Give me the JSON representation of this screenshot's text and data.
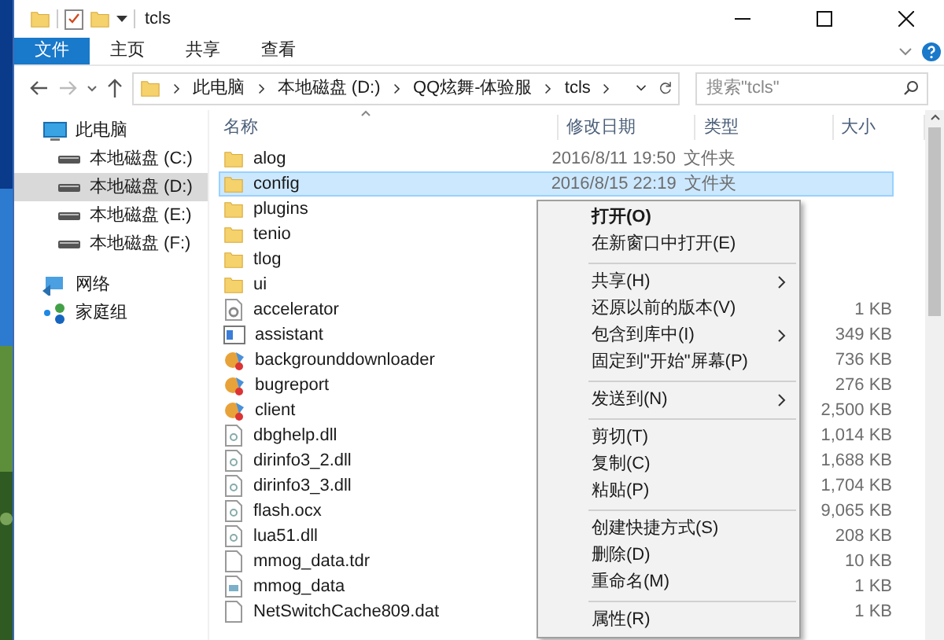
{
  "window": {
    "title": "tcls"
  },
  "ribbon_tabs": [
    {
      "label": "文件",
      "selected": true
    },
    {
      "label": "主页",
      "selected": false
    },
    {
      "label": "共享",
      "selected": false
    },
    {
      "label": "查看",
      "selected": false
    }
  ],
  "address_bar": {
    "crumbs": [
      "此电脑",
      "本地磁盘 (D:)",
      "QQ炫舞-体验服",
      "tcls"
    ]
  },
  "search": {
    "placeholder": "搜索\"tcls\""
  },
  "sidebar": {
    "items": [
      {
        "label": "此电脑",
        "kind": "pc",
        "selected": false
      },
      {
        "label": "本地磁盘 (C:)",
        "kind": "drive",
        "selected": false
      },
      {
        "label": "本地磁盘 (D:)",
        "kind": "drive",
        "selected": true
      },
      {
        "label": "本地磁盘 (E:)",
        "kind": "drive",
        "selected": false
      },
      {
        "label": "本地磁盘 (F:)",
        "kind": "drive",
        "selected": false
      },
      {
        "label": "网络",
        "kind": "network",
        "selected": false
      },
      {
        "label": "家庭组",
        "kind": "homegroup",
        "selected": false
      }
    ]
  },
  "table": {
    "columns": [
      "名称",
      "修改日期",
      "类型",
      "大小"
    ],
    "rows": [
      {
        "name": "alog",
        "kind": "folder",
        "selected": false,
        "date": "2016/8/11 19:50",
        "type": "文件夹"
      },
      {
        "name": "config",
        "kind": "folder",
        "selected": true,
        "date": "2016/8/15 22:19",
        "type": "文件夹"
      },
      {
        "name": "plugins",
        "kind": "folder",
        "selected": false
      },
      {
        "name": "tenio",
        "kind": "folder",
        "selected": false
      },
      {
        "name": "tlog",
        "kind": "folder",
        "selected": false
      },
      {
        "name": "ui",
        "kind": "folder",
        "selected": false
      },
      {
        "name": "accelerator",
        "kind": "settings",
        "selected": false,
        "size": "1 KB"
      },
      {
        "name": "assistant",
        "kind": "window",
        "selected": false,
        "size": "349 KB"
      },
      {
        "name": "backgrounddownloader",
        "kind": "app",
        "selected": false,
        "size": "736 KB"
      },
      {
        "name": "bugreport",
        "kind": "app",
        "selected": false,
        "size": "276 KB"
      },
      {
        "name": "client",
        "kind": "app",
        "selected": false,
        "size": "2,500 KB"
      },
      {
        "name": "dbghelp.dll",
        "kind": "dll",
        "selected": false,
        "size": "1,014 KB"
      },
      {
        "name": "dirinfo3_2.dll",
        "kind": "dll",
        "selected": false,
        "size": "1,688 KB"
      },
      {
        "name": "dirinfo3_3.dll",
        "kind": "dll",
        "selected": false,
        "size": "1,704 KB"
      },
      {
        "name": "flash.ocx",
        "kind": "dll",
        "selected": false,
        "size": "9,065 KB"
      },
      {
        "name": "lua51.dll",
        "kind": "dll",
        "selected": false,
        "size": "208 KB"
      },
      {
        "name": "mmog_data.tdr",
        "kind": "file",
        "selected": false,
        "size": "10 KB"
      },
      {
        "name": "mmog_data",
        "kind": "data",
        "selected": false,
        "size": "1 KB"
      },
      {
        "name": "NetSwitchCache809.dat",
        "kind": "file",
        "selected": false,
        "size": "1 KB"
      }
    ]
  },
  "context_menu": {
    "items": [
      {
        "kind": "item",
        "label": "打开(O)",
        "bold": true
      },
      {
        "kind": "item",
        "label": "在新窗口中打开(E)",
        "bold": false
      },
      {
        "kind": "separator"
      },
      {
        "kind": "submenu",
        "label": "共享(H)",
        "bold": false
      },
      {
        "kind": "item",
        "label": "还原以前的版本(V)",
        "bold": false
      },
      {
        "kind": "submenu",
        "label": "包含到库中(I)",
        "bold": false
      },
      {
        "kind": "item",
        "label": "固定到\"开始\"屏幕(P)",
        "bold": false
      },
      {
        "kind": "separator"
      },
      {
        "kind": "submenu",
        "label": "发送到(N)",
        "bold": false
      },
      {
        "kind": "separator"
      },
      {
        "kind": "item",
        "label": "剪切(T)",
        "bold": false
      },
      {
        "kind": "item",
        "label": "复制(C)",
        "bold": false
      },
      {
        "kind": "item",
        "label": "粘贴(P)",
        "bold": false
      },
      {
        "kind": "separator"
      },
      {
        "kind": "item",
        "label": "创建快捷方式(S)",
        "bold": false
      },
      {
        "kind": "item",
        "label": "删除(D)",
        "bold": false
      },
      {
        "kind": "item",
        "label": "重命名(M)",
        "bold": false
      },
      {
        "kind": "separator"
      },
      {
        "kind": "item",
        "label": "属性(R)",
        "bold": false
      }
    ]
  }
}
